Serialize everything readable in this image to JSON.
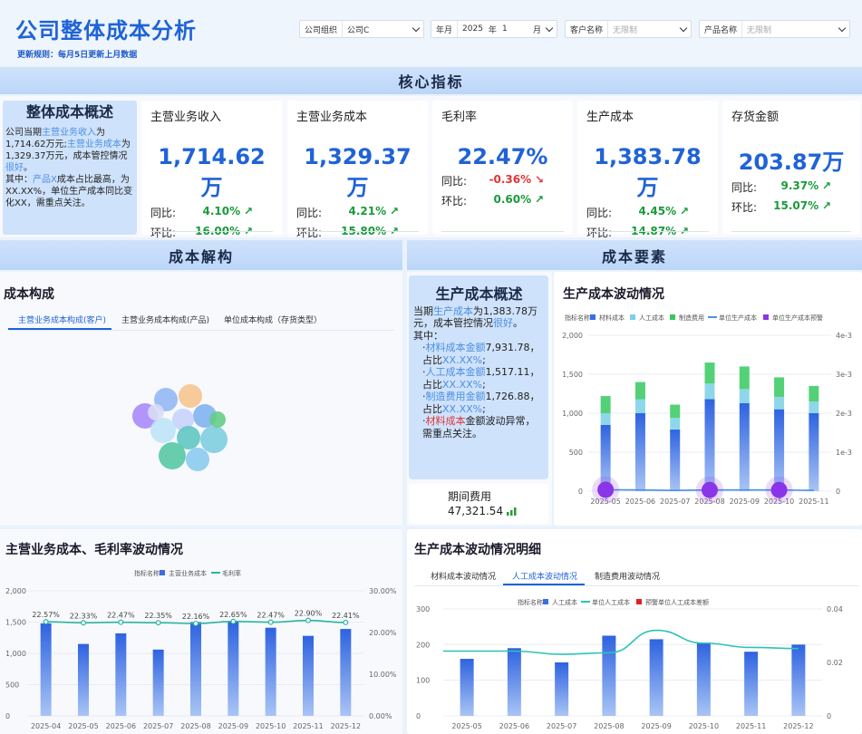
{
  "header": {
    "title": "公司整体成本分析",
    "update_rule": "更新规则：每月5日更新上月数据",
    "filters": {
      "org_label": "公司组织",
      "org_value": "公司C",
      "year_label": "年月",
      "year_value": "2025",
      "year_unit": "年",
      "month_value": "1",
      "month_unit": "月",
      "customer_label": "客户名称",
      "customer_placeholder": "无限制",
      "product_label": "产品名称",
      "product_placeholder": "无限制"
    }
  },
  "sections": {
    "core": "核心指标",
    "structure": "成本解构",
    "elements": "成本要素"
  },
  "overview": {
    "title": "整体成本概述",
    "p1": "公司当期",
    "hl1": "主营业务收入",
    "p2": "为1,714.62万元;",
    "hl2": "主营业务成本",
    "p3": "为1,329.37万元，成本管控情况",
    "hl3": "很好",
    "p4": "。",
    "p5": "其中：",
    "hl4": "产品X",
    "p6": "成本占比最高，为XX.XX%，单位生产成本同比变化XX，需重点关注。"
  },
  "kpis": [
    {
      "label": "主营业务收入",
      "value": "1,714.62万",
      "yoy_label": "同比:",
      "yoy": "4.10%",
      "yoy_dir": "up",
      "mom_label": "环比:",
      "mom": "16.00%",
      "mom_dir": "up"
    },
    {
      "label": "主营业务成本",
      "value": "1,329.37万",
      "yoy_label": "同比:",
      "yoy": "4.21%",
      "yoy_dir": "up",
      "mom_label": "环比:",
      "mom": "15.80%",
      "mom_dir": "up"
    },
    {
      "label": "毛利率",
      "value": "22.47%",
      "yoy_label": "同比:",
      "yoy": "-0.36%",
      "yoy_dir": "down",
      "mom_label": "环比:",
      "mom": "0.60%",
      "mom_dir": "up"
    },
    {
      "label": "生产成本",
      "value": "1,383.78万",
      "yoy_label": "同比:",
      "yoy": "4.45%",
      "yoy_dir": "up",
      "mom_label": "环比:",
      "mom": "14.87%",
      "mom_dir": "up"
    },
    {
      "label": "存货金额",
      "value": "203.87万",
      "yoy_label": "同比:",
      "yoy": "9.37%",
      "yoy_dir": "up",
      "mom_label": "环比:",
      "mom": "15.07%",
      "mom_dir": "up"
    }
  ],
  "cost_comp": {
    "title": "成本构成",
    "tabs": [
      "主营业务成本构成(客户)",
      "主营业务成本构成(产品)",
      "单位成本构成（存货类型）"
    ],
    "active_tab": 0,
    "bubble_colors": [
      "#a78bfa",
      "#93b8f5",
      "#f6c48f",
      "#7fb2f0",
      "#c6d3fb",
      "#bfe3f7",
      "#5fc6c2",
      "#7ecde0",
      "#56c8a4",
      "#8ccaf0",
      "#66cc88",
      "#d9dcf6"
    ]
  },
  "prod_overview": {
    "title": "生产成本概述",
    "l1a": "当期",
    "l1b": "生产成本",
    "l1c": "为1,383.78万元，成本管控情况",
    "l1d": "很好",
    "l1e": "。",
    "l2": "其中：",
    "items": [
      {
        "hl": "材料成本金额",
        "val": "7,931.78，占比",
        "x": "XX.XX%",
        "end": ";"
      },
      {
        "hl": "人工成本金额",
        "val": "1,517.11，占比",
        "x": "XX.XX%",
        "end": ";"
      },
      {
        "hl": "制造费用金额",
        "val": "1,726.88，占比",
        "x": "XX.XX%",
        "end": ";"
      }
    ],
    "warn_hl": "材料成本",
    "warn": "金额波动异常，需重点关注。"
  },
  "period_fee": {
    "label": "期间费用",
    "value": "47,321.54"
  },
  "chart_data": [
    {
      "id": "prod-wave",
      "title": "生产成本波动情况",
      "type": "bar",
      "legend_title": "指标名称",
      "categories": [
        "2025-05",
        "2025-06",
        "2025-07",
        "2025-08",
        "2025-09",
        "2025-10",
        "2025-11"
      ],
      "series": [
        {
          "name": "材料成本",
          "color": "#3b6fe0",
          "values": [
            850,
            1000,
            790,
            1180,
            1130,
            1050,
            1000
          ]
        },
        {
          "name": "人工成本",
          "color": "#7ad0e8",
          "values": [
            150,
            180,
            150,
            200,
            180,
            160,
            150
          ]
        },
        {
          "name": "制造费用",
          "color": "#36c95e",
          "values": [
            220,
            220,
            170,
            270,
            290,
            250,
            200
          ]
        },
        {
          "name": "单位生产成本",
          "color": "#4a90e2",
          "type": "line",
          "values": [
            3.5e-05,
            3e-05,
            2e-05,
            3e-05,
            3e-05,
            3e-05,
            2.2e-05
          ]
        },
        {
          "name": "单位生产成本预警",
          "color": "#8a35e8",
          "type": "scatter",
          "values": [
            3.5e-05,
            null,
            null,
            3e-05,
            null,
            3e-05,
            null
          ]
        }
      ],
      "yticks": [
        "0",
        "500",
        "1,000",
        "1,500",
        "2,000"
      ],
      "ylim": [
        0,
        2000
      ],
      "y2ticks": [
        "0",
        "1e-3",
        "2e-3",
        "3e-3",
        "4e-3"
      ],
      "y2lim": [
        0,
        0.004
      ]
    },
    {
      "id": "main-cost-wave",
      "title": "主营业务成本、毛利率波动情况",
      "type": "bar",
      "legend_title": "指标名称",
      "categories": [
        "2025-04",
        "2025-05",
        "2025-06",
        "2025-07",
        "2025-08",
        "2025-09",
        "2025-10",
        "2025-11",
        "2025-12"
      ],
      "series": [
        {
          "name": "主营业务成本",
          "color": "#3b6fe0",
          "values": [
            1480,
            1150,
            1320,
            1060,
            1500,
            1500,
            1410,
            1280,
            1390
          ]
        },
        {
          "name": "毛利率",
          "color": "#2bb5a0",
          "type": "line",
          "labels": [
            "22.57%",
            "22.33%",
            "22.47%",
            "22.35%",
            "22.16%",
            "22.65%",
            "22.47%",
            "22.90%",
            "22.41%"
          ],
          "values": [
            22.57,
            22.33,
            22.47,
            22.35,
            22.16,
            22.65,
            22.47,
            22.9,
            22.41
          ]
        }
      ],
      "yticks": [
        "0",
        "500",
        "1,000",
        "1,500",
        "2,000"
      ],
      "ylim": [
        0,
        2000
      ],
      "y2ticks": [
        "0.00%",
        "10.00%",
        "20.00%",
        "30.00%"
      ],
      "y2lim": [
        0,
        30
      ]
    },
    {
      "id": "labor-wave",
      "title": "生产成本波动情况明细",
      "tabs": [
        "材料成本波动情况",
        "人工成本波动情况",
        "制造费用波动情况"
      ],
      "active_tab": 1,
      "type": "bar",
      "legend_title": "指标名称",
      "categories": [
        "2025-05",
        "2025-06",
        "2025-07",
        "2025-08",
        "2025-09",
        "2025-10",
        "2025-11",
        "2025-12"
      ],
      "series": [
        {
          "name": "人工成本",
          "color": "#3b6fe0",
          "values": [
            160,
            190,
            150,
            225,
            215,
            205,
            180,
            200
          ]
        },
        {
          "name": "单位人工成本",
          "color": "#2bc4b4",
          "type": "line",
          "values": [
            0.0303,
            0.0303,
            0.0288,
            0.0295,
            0.04,
            0.034,
            0.032,
            0.0315
          ]
        },
        {
          "name": "预警单位人工成本差额",
          "color": "#e02020",
          "type": "scatter",
          "values": []
        }
      ],
      "yticks": [
        "0",
        "100",
        "200",
        "300"
      ],
      "ylim": [
        0,
        300
      ],
      "y2ticks": [
        "0",
        "0.02",
        "0.04"
      ],
      "y2lim": [
        0,
        0.05
      ]
    }
  ]
}
